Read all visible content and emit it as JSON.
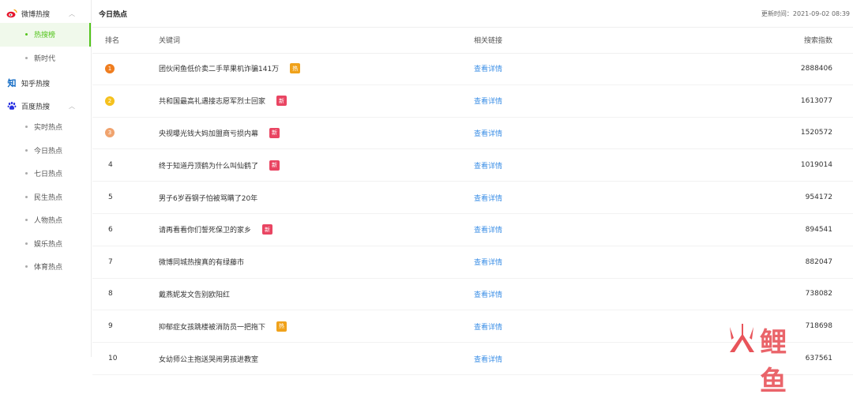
{
  "sidebar": {
    "weibo": {
      "label": "微博热搜",
      "items": [
        "热搜榜",
        "新时代"
      ]
    },
    "zhihu": {
      "label": "知乎热搜",
      "icon_text": "知"
    },
    "baidu": {
      "label": "百度热搜",
      "items": [
        "实时热点",
        "今日热点",
        "七日热点",
        "民生热点",
        "人物热点",
        "娱乐热点",
        "体育热点"
      ]
    }
  },
  "header": {
    "title": "今日热点",
    "update_time": "更新时间：2021-09-02 08:39"
  },
  "table": {
    "columns": [
      "排名",
      "关键词",
      "相关链接",
      "搜索指数"
    ],
    "link_text": "查看详情",
    "rows": [
      {
        "rank": "1",
        "keyword": "团伙闲鱼低价卖二手苹果机诈骗141万",
        "tag": "热",
        "score": "2888406"
      },
      {
        "rank": "2",
        "keyword": "共和国最高礼遇接志愿军烈士回家",
        "tag": "新",
        "score": "1613077"
      },
      {
        "rank": "3",
        "keyword": "央视曝光钱大妈加盟商亏损内幕",
        "tag": "新",
        "score": "1520572"
      },
      {
        "rank": "4",
        "keyword": "终于知道丹顶鹤为什么叫仙鹤了",
        "tag": "新",
        "score": "1019014"
      },
      {
        "rank": "5",
        "keyword": "男子6岁吞钢子怕被骂瞒了20年",
        "tag": "",
        "score": "954172"
      },
      {
        "rank": "6",
        "keyword": "请再看看你们誓死保卫的家乡",
        "tag": "新",
        "score": "894541"
      },
      {
        "rank": "7",
        "keyword": "微博同城热搜真的有绿藤市",
        "tag": "",
        "score": "882047"
      },
      {
        "rank": "8",
        "keyword": "戴燕妮发文告别欧阳红",
        "tag": "",
        "score": "738082"
      },
      {
        "rank": "9",
        "keyword": "抑郁症女孩跳楼被消防员一把拖下",
        "tag": "热",
        "score": "718698"
      },
      {
        "rank": "10",
        "keyword": "女幼师公主抱送哭闹男孩进教室",
        "tag": "",
        "score": "637561"
      }
    ]
  },
  "colors": {
    "accent_green": "#52c41a",
    "link_blue": "#3a8ee6",
    "rank1": "#ef7d1f",
    "rank2": "#f5c11d",
    "rank3": "#f0a36e",
    "tag_hot": "#f0a21b",
    "tag_new": "#e94562"
  },
  "watermark": {
    "text": "鲤鱼"
  },
  "icons": {
    "weibo": "weibo-icon",
    "zhihu": "zhihu-icon",
    "baidu": "baidu-paw-icon",
    "caret": "chevron-up-icon"
  }
}
